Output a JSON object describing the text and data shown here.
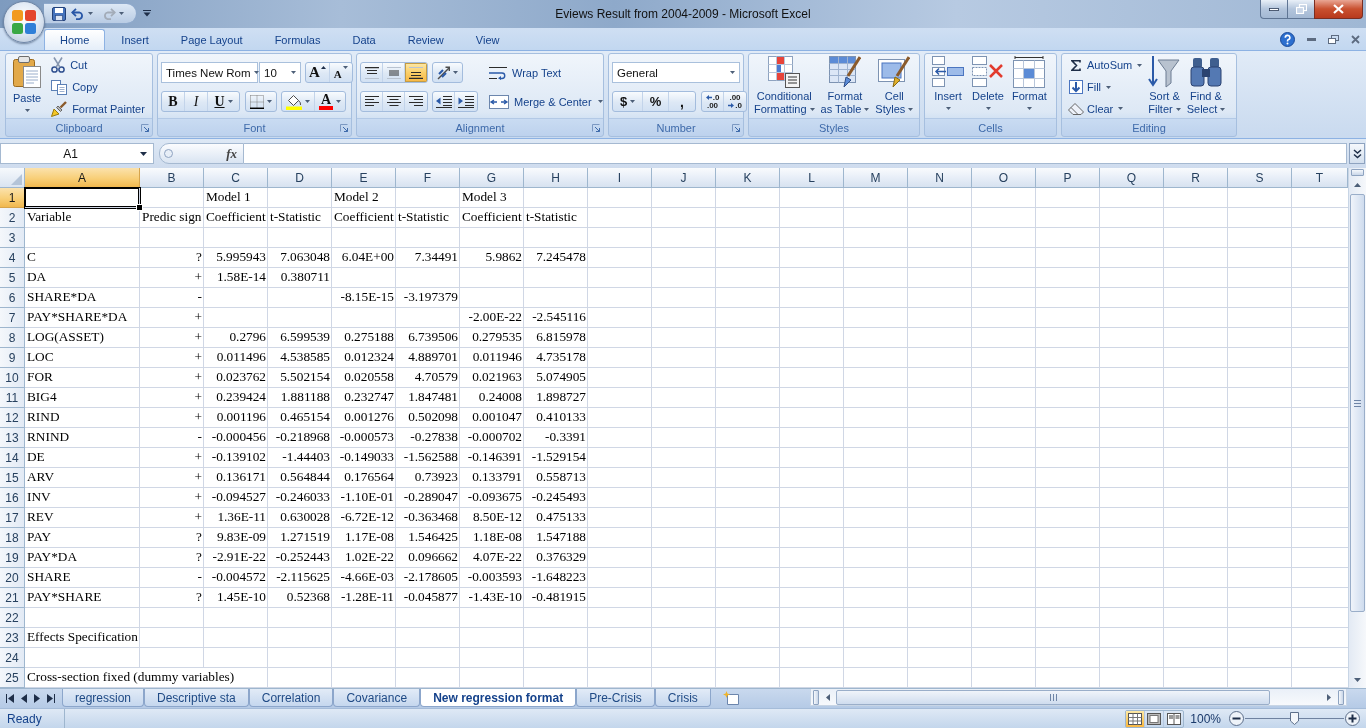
{
  "window": {
    "title": "Eviews Result from 2004-2009 - Microsoft Excel",
    "quick_access": [
      {
        "kind": "save",
        "disabled": false
      },
      {
        "kind": "undo",
        "disabled": false
      },
      {
        "kind": "redo",
        "disabled": true
      }
    ]
  },
  "ribbon": {
    "tabs": [
      {
        "label": "Home",
        "selected": true
      },
      {
        "label": "Insert",
        "selected": false
      },
      {
        "label": "Page Layout",
        "selected": false
      },
      {
        "label": "Formulas",
        "selected": false
      },
      {
        "label": "Data",
        "selected": false
      },
      {
        "label": "Review",
        "selected": false
      },
      {
        "label": "View",
        "selected": false
      }
    ],
    "clipboard": {
      "label": "Clipboard",
      "paste": "Paste",
      "commands": [
        {
          "kind": "cut",
          "label": "Cut"
        },
        {
          "kind": "copy",
          "label": "Copy"
        },
        {
          "kind": "painter",
          "label": "Format Painter"
        }
      ]
    },
    "font": {
      "label": "Font",
      "font_name": "Times New Rom",
      "font_size": "10",
      "size_buttons": [
        {
          "kind": "grow",
          "text": "A"
        },
        {
          "kind": "shrink",
          "text": "A"
        }
      ],
      "style_buttons": [
        {
          "kind": "bold",
          "text": "B"
        },
        {
          "kind": "italic",
          "text": "I"
        },
        {
          "kind": "underline",
          "text": "U"
        }
      ],
      "font_color": "A"
    },
    "alignment": {
      "label": "Alignment",
      "vertical": [
        {
          "kind": "top",
          "selected": false
        },
        {
          "kind": "middle",
          "selected": false
        },
        {
          "kind": "bottom",
          "selected": true
        }
      ],
      "horizontal": [
        {
          "kind": "left",
          "selected": false
        },
        {
          "kind": "center",
          "selected": false
        },
        {
          "kind": "right",
          "selected": false
        }
      ],
      "wrap_text": "Wrap Text",
      "merge": "Merge & Center"
    },
    "number": {
      "label": "Number",
      "format": "General",
      "symbols": [
        {
          "kind": "currency",
          "text": "$"
        },
        {
          "kind": "percent",
          "text": "%"
        },
        {
          "kind": "comma",
          "text": ","
        }
      ],
      "decimals": [
        {
          "kind": "increase",
          "lines": [
            ".0",
            ".00"
          ]
        },
        {
          "kind": "decrease",
          "lines": [
            ".00",
            ".0"
          ]
        }
      ]
    },
    "styles": {
      "label": "Styles",
      "commands": [
        {
          "kind": "conditional",
          "label": "Conditional Formatting"
        },
        {
          "kind": "table",
          "label": "Format as Table"
        },
        {
          "kind": "cellstyles",
          "label": "Cell Styles"
        }
      ]
    },
    "cells": {
      "label": "Cells",
      "commands": [
        {
          "kind": "insert",
          "label": "Insert"
        },
        {
          "kind": "delete",
          "label": "Delete"
        },
        {
          "kind": "format",
          "label": "Format"
        }
      ]
    },
    "editing": {
      "label": "Editing",
      "commands": [
        {
          "kind": "sum",
          "label": "AutoSum"
        },
        {
          "kind": "fill",
          "label": "Fill"
        },
        {
          "kind": "clear",
          "label": "Clear"
        }
      ],
      "big_commands": [
        {
          "kind": "sort",
          "label": "Sort & Filter"
        },
        {
          "kind": "find",
          "label": "Find & Select"
        }
      ]
    }
  },
  "formula_bar": {
    "name_box": "A1",
    "function_label": "fx"
  },
  "sheet": {
    "columns": [
      {
        "label": "A",
        "selected": true
      },
      {
        "label": "B",
        "selected": false
      },
      {
        "label": "C",
        "selected": false
      },
      {
        "label": "D",
        "selected": false
      },
      {
        "label": "E",
        "selected": false
      },
      {
        "label": "F",
        "selected": false
      },
      {
        "label": "G",
        "selected": false
      },
      {
        "label": "H",
        "selected": false
      },
      {
        "label": "I",
        "selected": false
      },
      {
        "label": "J",
        "selected": false
      },
      {
        "label": "K",
        "selected": false
      },
      {
        "label": "L",
        "selected": false
      },
      {
        "label": "M",
        "selected": false
      },
      {
        "label": "N",
        "selected": false
      },
      {
        "label": "O",
        "selected": false
      },
      {
        "label": "P",
        "selected": false
      },
      {
        "label": "Q",
        "selected": false
      },
      {
        "label": "R",
        "selected": false
      },
      {
        "label": "S",
        "selected": false
      },
      {
        "label": "T",
        "selected": false
      }
    ],
    "rows": [
      {
        "number": "1",
        "selected": true,
        "kind": "text",
        "cells": [
          null,
          null,
          "Model 1",
          null,
          "Model 2",
          null,
          "Model 3"
        ]
      },
      {
        "number": "2",
        "selected": false,
        "kind": "text",
        "cells": [
          "Variable",
          "Predic sign",
          "Coefficient",
          "t-Statistic",
          "Coefficient",
          "t-Statistic",
          "Coefficient",
          "t-Statistic"
        ]
      },
      {
        "number": "3",
        "selected": false
      },
      {
        "number": "4",
        "selected": false,
        "kind": "data",
        "cells": [
          "C",
          "?",
          "5.995943",
          "7.063048",
          "6.04E+00",
          "7.34491",
          "5.9862",
          "7.245478"
        ]
      },
      {
        "number": "5",
        "selected": false,
        "kind": "data",
        "cells": [
          "DA",
          "+",
          "1.58E-14",
          "0.380711"
        ]
      },
      {
        "number": "6",
        "selected": false,
        "kind": "data",
        "cells": [
          "SHARE*DA",
          "-",
          null,
          null,
          "-8.15E-15",
          "-3.197379"
        ]
      },
      {
        "number": "7",
        "selected": false,
        "kind": "data",
        "cells": [
          "PAY*SHARE*DA",
          "+",
          null,
          null,
          null,
          null,
          "-2.00E-22",
          "-2.545116"
        ]
      },
      {
        "number": "8",
        "selected": false,
        "kind": "data",
        "cells": [
          "LOG(ASSET)",
          "+",
          "0.2796",
          "6.599539",
          "0.275188",
          "6.739506",
          "0.279535",
          "6.815978"
        ]
      },
      {
        "number": "9",
        "selected": false,
        "kind": "data",
        "cells": [
          "LOC",
          "+",
          "0.011496",
          "4.538585",
          "0.012324",
          "4.889701",
          "0.011946",
          "4.735178"
        ]
      },
      {
        "number": "10",
        "selected": false,
        "kind": "data",
        "cells": [
          "FOR",
          "+",
          "0.023762",
          "5.502154",
          "0.020558",
          "4.70579",
          "0.021963",
          "5.074905"
        ]
      },
      {
        "number": "11",
        "selected": false,
        "kind": "data",
        "cells": [
          "BIG4",
          "+",
          "0.239424",
          "1.881188",
          "0.232747",
          "1.847481",
          "0.24008",
          "1.898727"
        ]
      },
      {
        "number": "12",
        "selected": false,
        "kind": "data",
        "cells": [
          "RIND",
          "+",
          "0.001196",
          "0.465154",
          "0.001276",
          "0.502098",
          "0.001047",
          "0.410133"
        ]
      },
      {
        "number": "13",
        "selected": false,
        "kind": "data",
        "cells": [
          "RNIND",
          "-",
          "-0.000456",
          "-0.218968",
          "-0.000573",
          "-0.27838",
          "-0.000702",
          "-0.3391"
        ]
      },
      {
        "number": "14",
        "selected": false,
        "kind": "data",
        "cells": [
          "DE",
          "+",
          "-0.139102",
          "-1.44403",
          "-0.149033",
          "-1.562588",
          "-0.146391",
          "-1.529154"
        ]
      },
      {
        "number": "15",
        "selected": false,
        "kind": "data",
        "cells": [
          "ARV",
          "+",
          "0.136171",
          "0.564844",
          "0.176564",
          "0.73923",
          "0.133791",
          "0.558713"
        ]
      },
      {
        "number": "16",
        "selected": false,
        "kind": "data",
        "cells": [
          "INV",
          "+",
          "-0.094527",
          "-0.246033",
          "-1.10E-01",
          "-0.289047",
          "-0.093675",
          "-0.245493"
        ]
      },
      {
        "number": "17",
        "selected": false,
        "kind": "data",
        "cells": [
          "REV",
          "+",
          "1.36E-11",
          "0.630028",
          "-6.72E-12",
          "-0.363468",
          "8.50E-12",
          "0.475133"
        ]
      },
      {
        "number": "18",
        "selected": false,
        "kind": "data",
        "cells": [
          "PAY",
          "?",
          "9.83E-09",
          "1.271519",
          "1.17E-08",
          "1.546425",
          "1.18E-08",
          "1.547188"
        ]
      },
      {
        "number": "19",
        "selected": false,
        "kind": "data",
        "cells": [
          "PAY*DA",
          "?",
          "-2.91E-22",
          "-0.252443",
          "1.02E-22",
          "0.096662",
          "4.07E-22",
          "0.376329"
        ]
      },
      {
        "number": "20",
        "selected": false,
        "kind": "data",
        "cells": [
          "SHARE",
          "-",
          "-0.004572",
          "-2.115625",
          "-4.66E-03",
          "-2.178605",
          "-0.003593",
          "-1.648223"
        ]
      },
      {
        "number": "21",
        "selected": false,
        "kind": "data",
        "cells": [
          "PAY*SHARE",
          "?",
          "1.45E-10",
          "0.52368",
          "-1.28E-11",
          "-0.045877",
          "-1.43E-10",
          "-0.481915"
        ]
      },
      {
        "number": "22",
        "selected": false
      },
      {
        "number": "23",
        "selected": false,
        "kind": "text",
        "cells": [
          "Effects Specification"
        ]
      },
      {
        "number": "24",
        "selected": false
      },
      {
        "number": "25",
        "selected": false,
        "kind": "text",
        "cells": [
          "Cross-section fixed (dummy variables)"
        ]
      }
    ]
  },
  "sheet_tabs": [
    {
      "label": "regression",
      "selected": false
    },
    {
      "label": "Descriptive sta",
      "selected": false
    },
    {
      "label": "Correlation",
      "selected": false
    },
    {
      "label": "Covariance",
      "selected": false
    },
    {
      "label": "New regression format",
      "selected": true
    },
    {
      "label": "Pre-Crisis",
      "selected": false
    },
    {
      "label": "Crisis",
      "selected": false
    }
  ],
  "status_bar": {
    "text": "Ready",
    "views": [
      {
        "kind": "normal",
        "selected": true
      },
      {
        "kind": "layout",
        "selected": false
      },
      {
        "kind": "preview",
        "selected": false
      }
    ],
    "zoom": {
      "label": "100%",
      "level": 0.5
    }
  }
}
